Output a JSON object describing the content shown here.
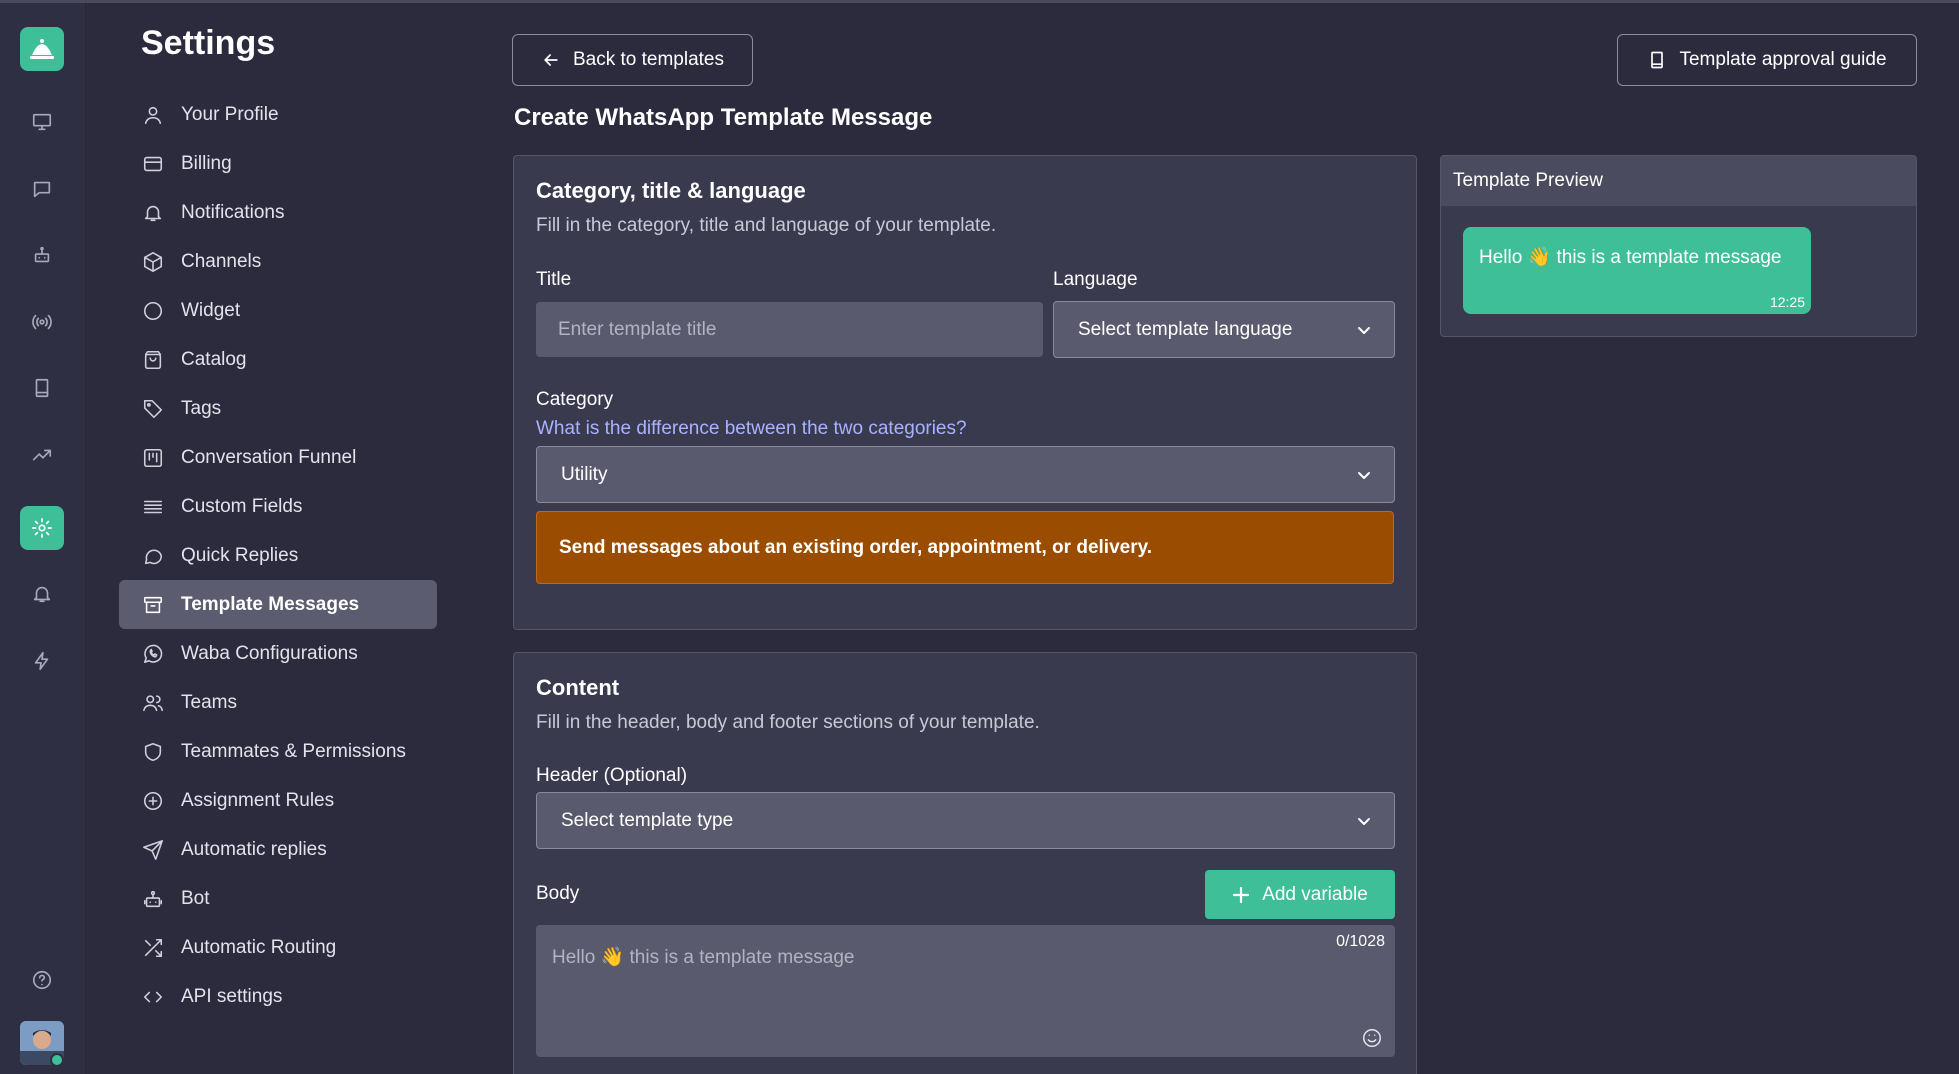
{
  "settings_title": "Settings",
  "menu": [
    {
      "label": "Your Profile",
      "icon": "user-icon"
    },
    {
      "label": "Billing",
      "icon": "credit-card-icon"
    },
    {
      "label": "Notifications",
      "icon": "bell-icon"
    },
    {
      "label": "Channels",
      "icon": "cube-icon"
    },
    {
      "label": "Widget",
      "icon": "circle-icon"
    },
    {
      "label": "Catalog",
      "icon": "shopping-bag-icon"
    },
    {
      "label": "Tags",
      "icon": "tag-icon"
    },
    {
      "label": "Conversation Funnel",
      "icon": "kanban-icon"
    },
    {
      "label": "Custom Fields",
      "icon": "lines-icon"
    },
    {
      "label": "Quick Replies",
      "icon": "chat-bubble-icon"
    },
    {
      "label": "Template Messages",
      "icon": "archive-icon",
      "active": true
    },
    {
      "label": "Waba Configurations",
      "icon": "whatsapp-icon"
    },
    {
      "label": "Teams",
      "icon": "users-icon"
    },
    {
      "label": "Teammates & Permissions",
      "icon": "shield-icon"
    },
    {
      "label": "Assignment Rules",
      "icon": "plus-circle-icon"
    },
    {
      "label": "Automatic replies",
      "icon": "send-icon"
    },
    {
      "label": "Bot",
      "icon": "robot-icon"
    },
    {
      "label": "Automatic Routing",
      "icon": "shuffle-icon"
    },
    {
      "label": "API settings",
      "icon": "code-icon"
    }
  ],
  "rail": [
    "monitor-icon",
    "chat-icon",
    "robot-icon",
    "broadcast-icon",
    "book-icon",
    "trending-up-icon",
    "gear-icon",
    "bell-icon",
    "lightning-icon",
    "help-icon"
  ],
  "header": {
    "back_label": "Back to templates",
    "guide_label": "Template approval guide",
    "page_title": "Create WhatsApp Template Message"
  },
  "category_card": {
    "title": "Category, title & language",
    "subtitle": "Fill in the category, title and language of your template.",
    "title_label": "Title",
    "title_placeholder": "Enter template title",
    "language_label": "Language",
    "language_value": "Select template language",
    "category_label": "Category",
    "category_link": "What is the difference between the two categories?",
    "category_value": "Utility",
    "category_alert": "Send messages about an existing order, appointment, or delivery."
  },
  "content_card": {
    "title": "Content",
    "subtitle": "Fill in the header, body and footer sections of your template.",
    "header_label": "Header (Optional)",
    "header_value": "Select template type",
    "body_label": "Body",
    "add_variable_label": "Add variable",
    "body_placeholder": "Hello 👋 this is a template message",
    "body_counter": "0/1028"
  },
  "preview": {
    "title": "Template Preview",
    "message": "Hello 👋 this is a template message",
    "time": "12:25"
  },
  "colors": {
    "accent": "#3fbf98",
    "background": "#2b2b3d",
    "card": "#3a3a4f",
    "alert": "#9a4d00",
    "link": "#a9b2ff"
  }
}
